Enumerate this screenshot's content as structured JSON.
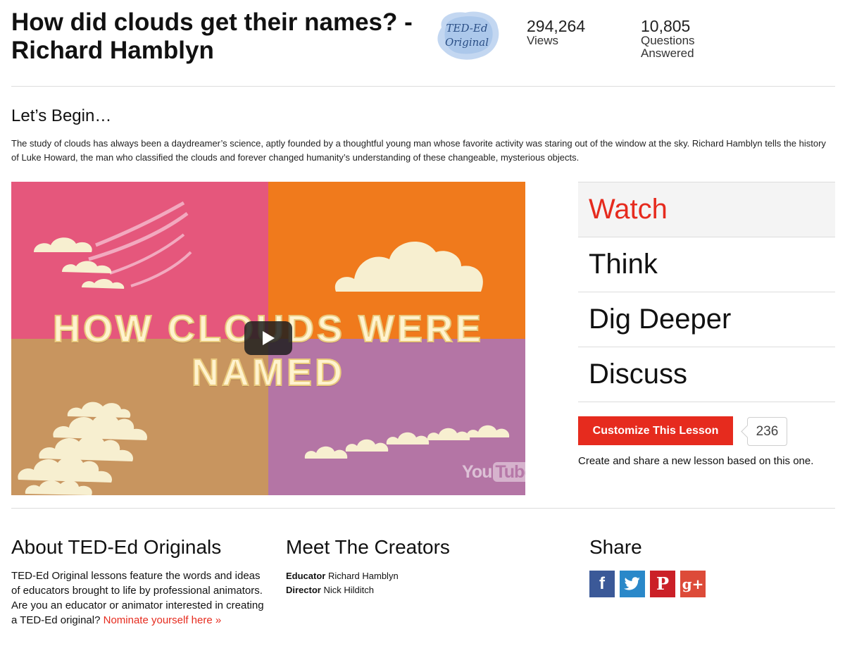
{
  "header": {
    "title": "How did clouds get their names? - Richard Hamblyn",
    "badge_line1": "TED-Ed",
    "badge_line2": "Original",
    "views_count": "294,264",
    "views_label": "Views",
    "questions_count": "10,805",
    "questions_label_1": "Questions",
    "questions_label_2": "Answered"
  },
  "intro": {
    "heading": "Let’s Begin…",
    "text": "The study of clouds has always been a daydreamer’s science, aptly founded by a thoughtful young man whose favorite activity was staring out of the window at the sky. Richard Hamblyn tells the history of Luke Howard, the man who classified the clouds and forever changed humanity’s understanding of these changeable, mysterious objects."
  },
  "video": {
    "title_text": "HOW CLOUDS WERE NAMED",
    "youtube_logo_you": "You",
    "youtube_logo_tube": "Tube",
    "colors": {
      "pink": "#e5577c",
      "orange": "#f07a1c",
      "tan": "#c8955f",
      "purple": "#b475a5",
      "cloud": "#f7efd0"
    }
  },
  "tabs": [
    {
      "label": "Watch",
      "active": true
    },
    {
      "label": "Think",
      "active": false
    },
    {
      "label": "Dig Deeper",
      "active": false
    },
    {
      "label": "Discuss",
      "active": false
    }
  ],
  "customize": {
    "button_label": "Customize This Lesson",
    "count": "236",
    "note": "Create and share a new lesson based on this one."
  },
  "about": {
    "title": "About TED-Ed Originals",
    "body": "TED-Ed Original lessons feature the words and ideas of educators brought to life by professional animators. Are you an educator or animator interested in creating a TED-Ed original?",
    "link": "Nominate yourself here »"
  },
  "creators": {
    "title": "Meet The Creators",
    "educator_label": "Educator",
    "educator_name": "Richard Hamblyn",
    "director_label": "Director",
    "director_name": "Nick Hilditch"
  },
  "share": {
    "title": "Share",
    "buttons": [
      {
        "icon": "facebook-icon",
        "glyph": "f",
        "color": "#3b5998"
      },
      {
        "icon": "twitter-icon",
        "glyph": "",
        "color": "#2a88c9"
      },
      {
        "icon": "pinterest-icon",
        "glyph": "P",
        "color": "#cb2027"
      },
      {
        "icon": "google-plus-icon",
        "glyph": "g+",
        "color": "#dd4b39"
      }
    ]
  },
  "accent": "#e62b1e"
}
